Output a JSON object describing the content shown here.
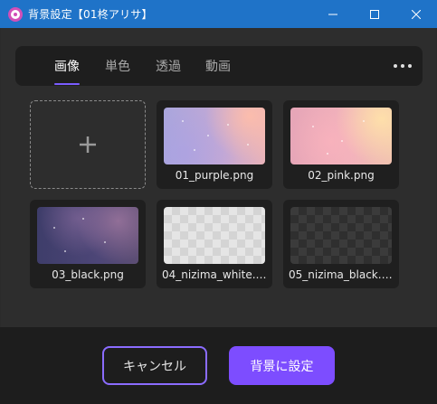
{
  "window": {
    "title": "背景設定【01柊アリサ】",
    "accent": "#1f73c8"
  },
  "tabs": [
    {
      "label": "画像",
      "active": true
    },
    {
      "label": "単色",
      "active": false
    },
    {
      "label": "透過",
      "active": false
    },
    {
      "label": "動画",
      "active": false
    }
  ],
  "more_icon": "more-horizontal-icon",
  "add_icon": "plus-icon",
  "images": [
    {
      "label": "01_purple.png"
    },
    {
      "label": "02_pink.png"
    },
    {
      "label": "03_black.png"
    },
    {
      "label": "04_nizima_white.png"
    },
    {
      "label": "05_nizima_black.png"
    }
  ],
  "footer": {
    "cancel_label": "キャンセル",
    "confirm_label": "背景に設定"
  },
  "colors": {
    "primary": "#7d4dff",
    "tab_underline": "#7a5cff"
  }
}
